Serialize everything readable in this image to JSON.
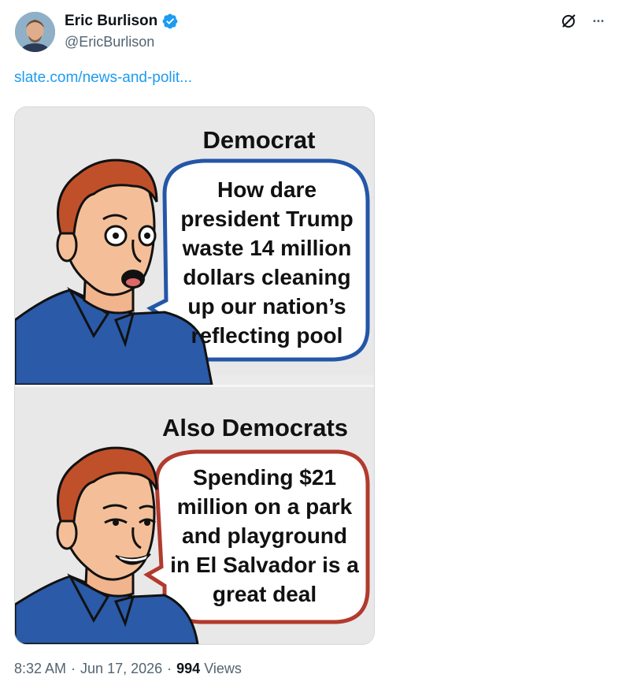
{
  "author": {
    "name": "Eric Burlison",
    "handle": "@EricBurlison",
    "verified": true,
    "avatar_icon": "avatar-photo"
  },
  "toolbar": {
    "grok_icon": "grok-icon",
    "more_icon": "more-icon",
    "more_label": "···"
  },
  "tweet": {
    "link_text": "slate.com/news-and-polit..."
  },
  "image": {
    "panel1": {
      "title": "Democrat",
      "bubble": [
        "How dare",
        "president Trump",
        "waste 14 million",
        "dollars cleaning",
        "up our nation’s",
        "reflecting pool"
      ],
      "bubble_color": "#2456a8"
    },
    "panel2": {
      "title": "Also Democrats",
      "bubble": [
        "Spending $21",
        "million on a park",
        "and playground",
        "in El Salvador is a",
        "great deal"
      ],
      "bubble_color": "#b23a2e"
    }
  },
  "meta": {
    "time": "8:32 AM",
    "sep1": "·",
    "date": "Jun 17, 2026",
    "sep2": "·",
    "views_count": "994",
    "views_label": "Views"
  },
  "colors": {
    "link": "#1d9bf0",
    "verified": "#1d9bf0",
    "secondary_text": "#536471"
  }
}
